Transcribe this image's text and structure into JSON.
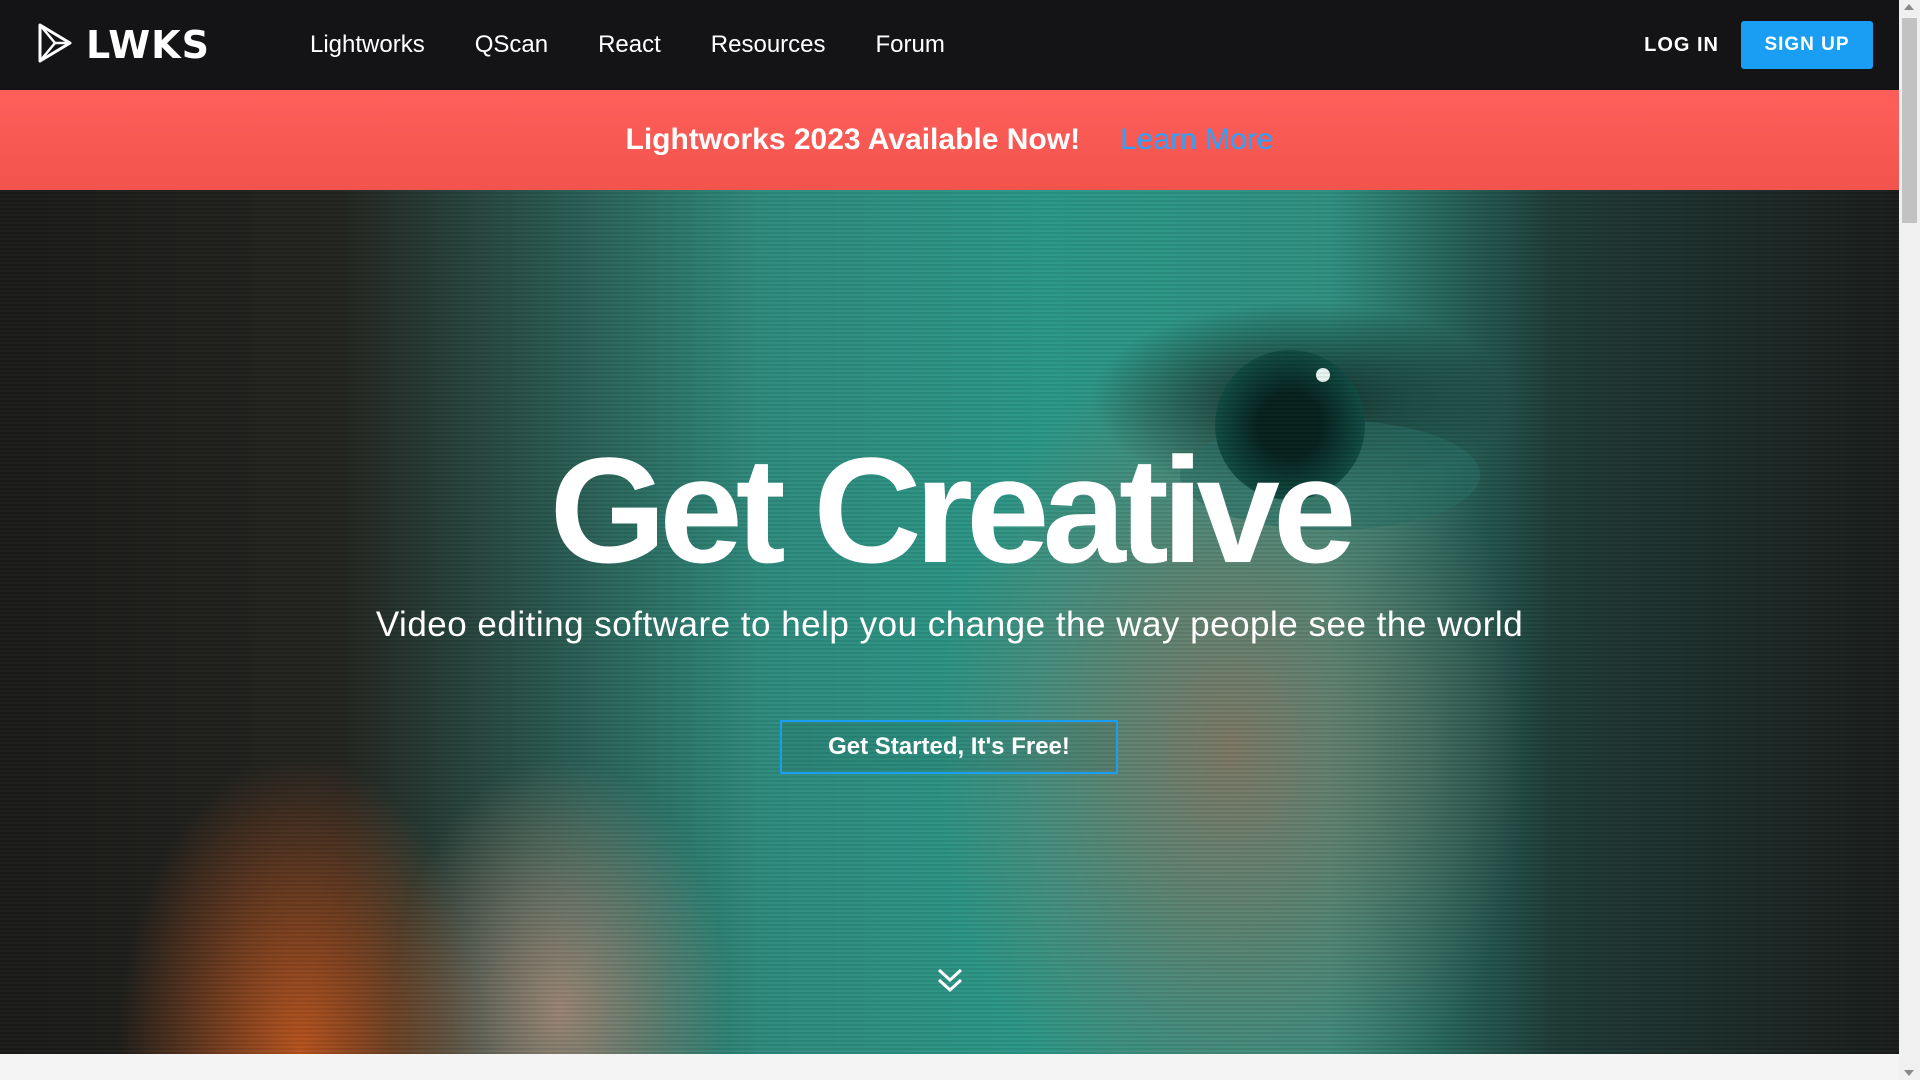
{
  "header": {
    "logo_text": "LWKS",
    "logo_icon": "play-triangle-icon",
    "nav": [
      "Lightworks",
      "QScan",
      "React",
      "Resources",
      "Forum"
    ],
    "login_label": "LOG IN",
    "signup_label": "SIGN UP"
  },
  "announcement": {
    "text": "Lightworks 2023 Available Now!",
    "link_label": "Learn More"
  },
  "hero": {
    "title": "Get Creative",
    "subtitle": "Video editing software to help you change the way people see the world",
    "cta_label": "Get Started, It's Free!",
    "scroll_icon": "double-chevron-down-icon"
  },
  "colors": {
    "nav_bg": "#141416",
    "accent_blue": "#1a9ef4",
    "banner_red": "#f2534d"
  }
}
